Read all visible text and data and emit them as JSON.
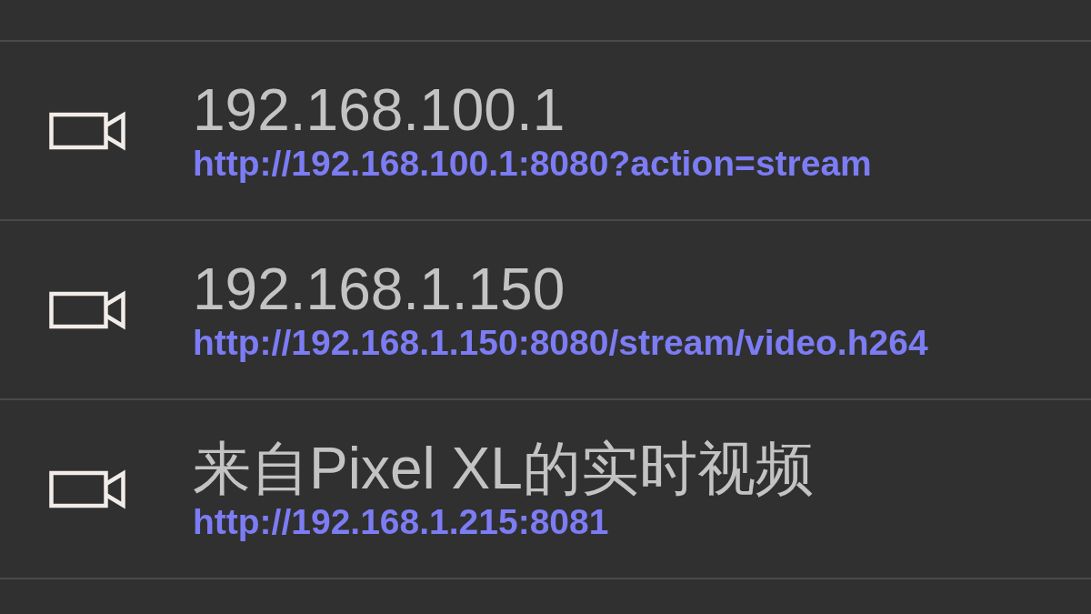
{
  "streams": [
    {
      "title": "192.168.100.1",
      "url": "http://192.168.100.1:8080?action=stream"
    },
    {
      "title": "192.168.1.150",
      "url": "http://192.168.1.150:8080/stream/video.h264"
    },
    {
      "title": "来自Pixel XL的实时视频",
      "url": "http://192.168.1.215:8081"
    }
  ]
}
